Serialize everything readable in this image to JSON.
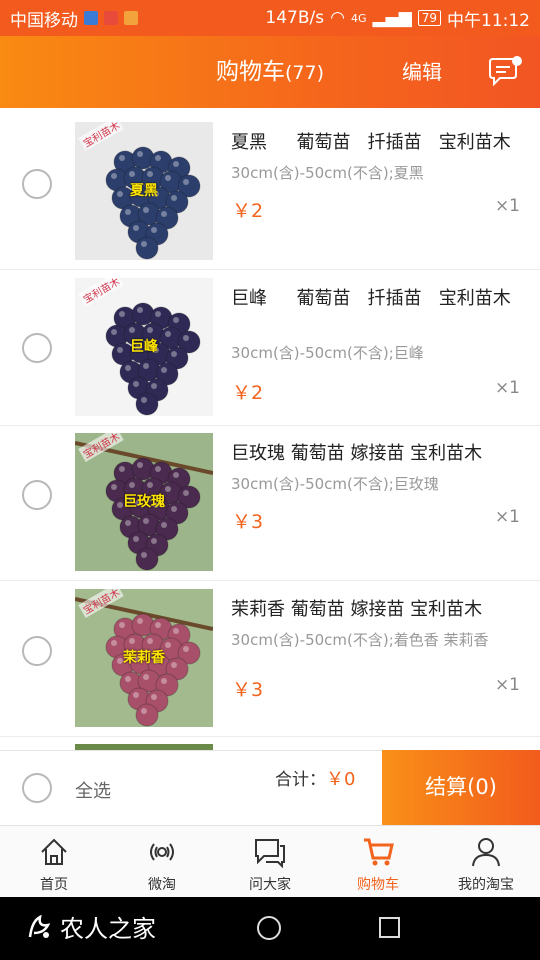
{
  "status_bar": {
    "carrier": "中国移动",
    "speed": "147B/s",
    "network": "4G",
    "battery": "79",
    "time": "中午11:12"
  },
  "header": {
    "title": "购物车",
    "count": "(77)",
    "edit_label": "编辑",
    "message_icon": "message-icon"
  },
  "cart_items": [
    {
      "name": "夏黑　  葡萄苗   扦插苗   宝利苗木",
      "spec": "30cm(含)-50cm(不含);夏黑",
      "price": "￥2",
      "qty": "×1",
      "image_label": "夏黑",
      "watermark": "宝利苗木",
      "grape_color": "#2c3e6b"
    },
    {
      "name": "巨峰　  葡萄苗   扦插苗   宝利苗木",
      "spec": "30cm(含)-50cm(不含);巨峰",
      "price": "￥2",
      "qty": "×1",
      "image_label": "巨峰",
      "watermark": "宝利苗木",
      "grape_color": "#2e2a55"
    },
    {
      "name": "巨玫瑰 葡萄苗 嫁接苗 宝利苗木",
      "spec": "30cm(含)-50cm(不含);巨玫瑰",
      "price": "￥3",
      "qty": "×1",
      "image_label": "巨玫瑰",
      "watermark": "宝利苗木",
      "grape_color": "#4a2a4e"
    },
    {
      "name": "茉莉香 葡萄苗 嫁接苗 宝利苗木",
      "spec": "30cm(含)-50cm(不含);着色香 茉莉香",
      "price": "￥3",
      "qty": "×1",
      "image_label": "茉莉香",
      "watermark": "宝利苗木",
      "grape_color": "#a8506a"
    }
  ],
  "checkout": {
    "select_all_label": "全选",
    "total_label": "合计：",
    "total_value": "￥0",
    "pay_label": "结算(0)"
  },
  "tabs": [
    {
      "label": "首页",
      "icon": "home-icon"
    },
    {
      "label": "微淘",
      "icon": "broadcast-icon"
    },
    {
      "label": "问大家",
      "icon": "chat-icon"
    },
    {
      "label": "购物车",
      "icon": "cart-icon",
      "active": true
    },
    {
      "label": "我的淘宝",
      "icon": "user-icon"
    }
  ],
  "nav": {
    "brand": "农人之家"
  },
  "colors": {
    "accent": "#f2641e",
    "header_start": "#f98a12",
    "header_end": "#f25523"
  }
}
